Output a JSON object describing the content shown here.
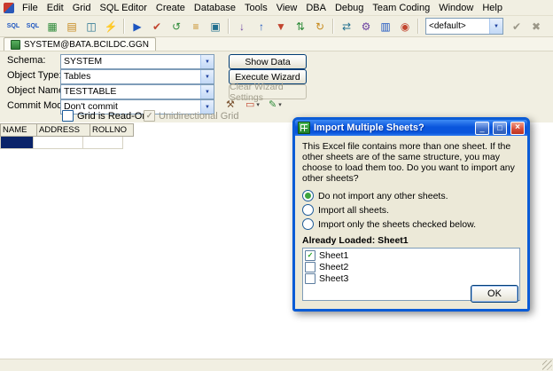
{
  "menu": {
    "items": [
      "File",
      "Edit",
      "Grid",
      "SQL Editor",
      "Create",
      "Database",
      "Tools",
      "View",
      "DBA",
      "Debug",
      "Team Coding",
      "Window",
      "Help"
    ]
  },
  "toolbar": {
    "icons": [
      {
        "name": "new-sql-file-icon",
        "glyph": "SQL"
      },
      {
        "name": "open-sql-file-icon",
        "glyph": "SQL"
      },
      {
        "name": "schema-browser-icon",
        "glyph": "▦"
      },
      {
        "name": "sql-editor-icon",
        "glyph": "▤"
      },
      {
        "name": "session-browser-icon",
        "glyph": "◫"
      },
      {
        "name": "new-connection-icon",
        "glyph": "⚡"
      },
      {
        "name": "execute-icon",
        "glyph": "▶"
      },
      {
        "name": "commit-icon",
        "glyph": "✔"
      },
      {
        "name": "rollback-icon",
        "glyph": "↺"
      },
      {
        "name": "describe-objects-icon",
        "glyph": "≡"
      },
      {
        "name": "object-palette-icon",
        "glyph": "▣"
      },
      {
        "name": "data-export-icon",
        "glyph": "↓"
      },
      {
        "name": "data-import-icon",
        "glyph": "↑"
      },
      {
        "name": "filter-icon",
        "glyph": "▼"
      },
      {
        "name": "sort-icon",
        "glyph": "⇅"
      },
      {
        "name": "refresh-icon",
        "glyph": "↻"
      },
      {
        "name": "compare-icon",
        "glyph": "⇄"
      },
      {
        "name": "team-coding-icon",
        "glyph": "⚙"
      },
      {
        "name": "report-manager-icon",
        "glyph": "▥"
      },
      {
        "name": "monitor-icon",
        "glyph": "◉"
      }
    ],
    "combo_value": "<default>",
    "right_icons": [
      {
        "name": "apply-filter-icon",
        "glyph": "✔"
      },
      {
        "name": "cancel-filter-icon",
        "glyph": "✖"
      }
    ]
  },
  "connection_tab": {
    "label": "SYSTEM@BATA.BCILDC.GGN"
  },
  "form": {
    "schema_label": "Schema:",
    "schema_value": "SYSTEM",
    "object_type_label": "Object Type:",
    "object_type_value": "Tables",
    "object_name_label": "Object Name:",
    "object_name_value": "TESTTABLE",
    "commit_mode_label": "Commit Mode:",
    "commit_mode_value": "Don't commit",
    "show_data_button": "Show Data",
    "execute_wizard_button": "Execute Wizard",
    "clear_wizard_button": "Clear Wizard Settings",
    "grid_readonly_checkbox": {
      "label": "Grid is Read-Only",
      "checked": false
    },
    "unidirectional_checkbox": {
      "label": "Unidirectional Grid",
      "checked": true,
      "disabled": true
    },
    "tool_icons": [
      {
        "name": "wizard-tools-icon",
        "glyph": "⚒"
      },
      {
        "name": "clear-data-icon",
        "glyph": "▭"
      },
      {
        "name": "grid-edit-icon",
        "glyph": "✎"
      }
    ]
  },
  "grid": {
    "columns": [
      "NAME",
      "ADDRESS",
      "ROLLNO"
    ],
    "rows": [
      [
        "",
        "",
        ""
      ]
    ],
    "selected_cell": {
      "row": 0,
      "column": "NAME"
    },
    "selection_color": "#0A246A"
  },
  "dialog": {
    "title": "Import Multiple Sheets?",
    "window_buttons": {
      "minimize": "_",
      "maximize": "□",
      "close": "×"
    },
    "body_text": "This Excel file contains more than one sheet.  If the other sheets are of the same structure, you may choose to load them too.  Do you want to import any other sheets?",
    "radios": [
      {
        "label": "Do not import any other sheets.",
        "selected": true
      },
      {
        "label": "Import all sheets.",
        "selected": false
      },
      {
        "label": "Import only the sheets checked below.",
        "selected": false
      }
    ],
    "already_loaded_label": "Already Loaded: Sheet1",
    "sheets": [
      {
        "label": "Sheet1",
        "checked": true
      },
      {
        "label": "Sheet2",
        "checked": false
      },
      {
        "label": "Sheet3",
        "checked": false
      }
    ],
    "ok_button": "OK",
    "accent_color": "#0B5CD6"
  }
}
